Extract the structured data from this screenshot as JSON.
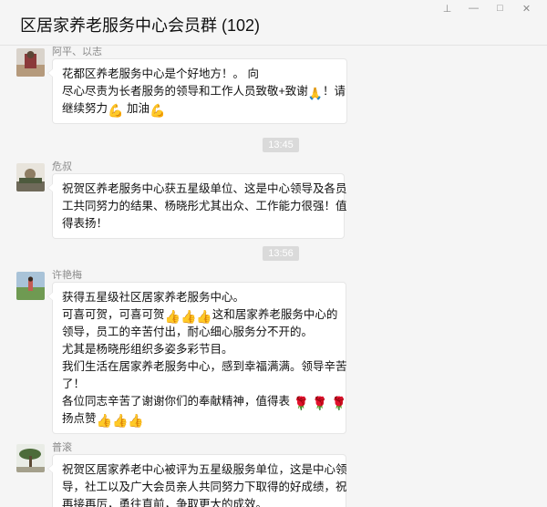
{
  "window": {
    "title": "区居家养老服务中心会员群 (102)",
    "buttons": [
      {
        "icon": "pin-icon",
        "glyph": "⊥"
      },
      {
        "icon": "minimize-icon",
        "glyph": "—"
      },
      {
        "icon": "maximize-icon",
        "glyph": "□"
      },
      {
        "icon": "close-icon",
        "glyph": "✕"
      }
    ]
  },
  "timestamps": [
    "13:45",
    "13:56"
  ],
  "messages": [
    {
      "sender": "阿平、以志",
      "lines": [
        "花都区养老服务中心是个好地方！。              向",
        "尽心尽责为长者服务的领导和工作人员致敬+致谢",
        "！请",
        "继续努力",
        "加油"
      ]
    },
    {
      "sender": "危叔",
      "lines": [
        "祝贺区养老服务中心获五星级单位、这是中心领导及各员",
        "工共同努力的结果、杨晓彤尤其出众、工作能力很强！值",
        "得表扬！"
      ]
    },
    {
      "sender": "许艳梅",
      "lines": [
        "获得五星级社区居家养老服务中心。",
        "可喜可贺，可喜可贺",
        "这和居家养老服务中心的",
        "领导，员工的辛苦付出，耐心细心服务分不开的。",
        "尤其是杨晓彤组织多姿多彩节目。",
        "我们生活在居家养老服务中心，感到幸福满满。领导辛苦",
        "了！",
        "各位同志辛苦了谢谢你们的奉献精神，值得表",
        "扬点赞"
      ]
    },
    {
      "sender": "普滚",
      "lines": [
        "祝贺区居家养老中心被评为五星级服务单位，这是中心领",
        "导，社工以及广大会员亲人共同努力下取得的好成绩，祝",
        "再接再厉，勇往直前，争取更大的成效。"
      ]
    }
  ],
  "emoji": {
    "pray": "🙏",
    "flexed_biceps": "💪",
    "thumbs_up": "👍",
    "rose": "🌹"
  }
}
